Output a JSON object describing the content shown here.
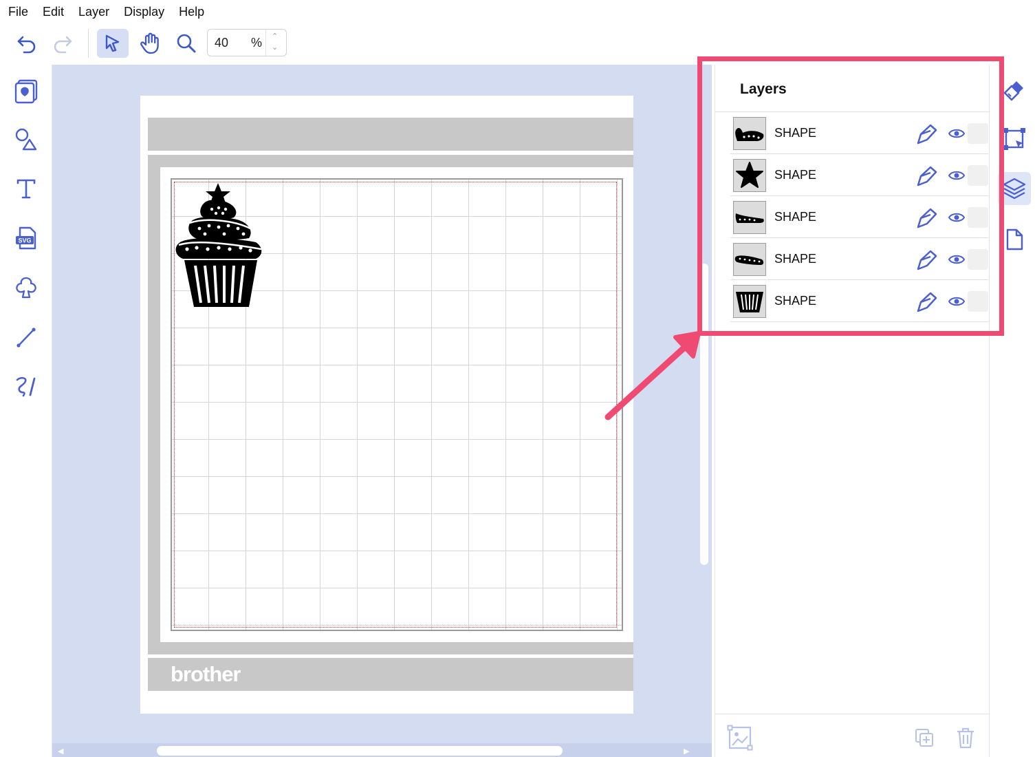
{
  "menu": [
    "File",
    "Edit",
    "Layer",
    "Display",
    "Help"
  ],
  "toolbar": {
    "undo_icon": "undo-icon",
    "redo_icon": "redo-icon",
    "select_icon": "pointer-select-icon",
    "pan_icon": "hand-pan-icon",
    "zoom_icon": "magnifier-icon",
    "zoom_value": "40",
    "zoom_unit": "%"
  },
  "left_tools": [
    "template-library-icon",
    "shapes-icon",
    "text-icon",
    "svg-import-icon",
    "outline-icon",
    "line-icon",
    "freehand-icon"
  ],
  "canvas": {
    "brand": "brother",
    "accent_color": "#4a5fd0",
    "highlight_color": "#ee4a72",
    "cut_line_color": "#e02020"
  },
  "layers_panel": {
    "title": "Layers",
    "layers": [
      {
        "name": "SHAPE",
        "thumb": "frosting-top-swirl"
      },
      {
        "name": "SHAPE",
        "thumb": "star"
      },
      {
        "name": "SHAPE",
        "thumb": "frosting-middle-swirl"
      },
      {
        "name": "SHAPE",
        "thumb": "frosting-bottom-swirl"
      },
      {
        "name": "SHAPE",
        "thumb": "cupcake-liner"
      }
    ]
  },
  "right_strip": [
    "paint-brush-icon",
    "transform-icon",
    "layers-icon",
    "page-icon"
  ]
}
